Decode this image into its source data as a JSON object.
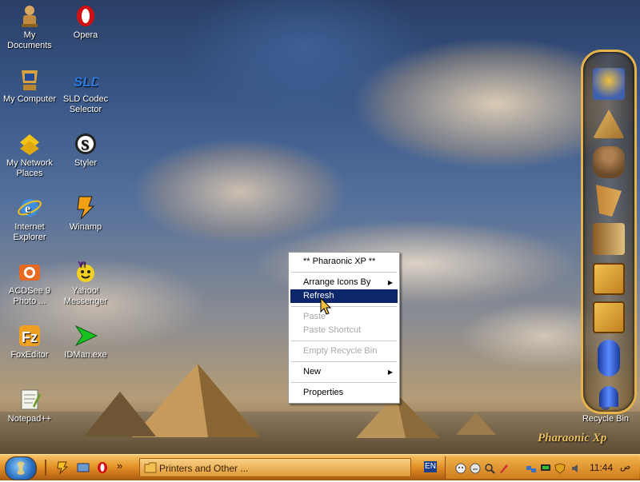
{
  "desktop_icons": [
    {
      "label": "My\nDocuments",
      "icon": "my-documents-icon"
    },
    {
      "label": "Opera",
      "icon": "opera-icon"
    },
    {
      "label": "My Computer",
      "icon": "my-computer-icon"
    },
    {
      "label": "SLD Codec\nSelector",
      "icon": "sld-codec-icon"
    },
    {
      "label": "My Network\nPlaces",
      "icon": "network-places-icon"
    },
    {
      "label": "Styler",
      "icon": "styler-icon"
    },
    {
      "label": "Internet\nExplorer",
      "icon": "internet-explorer-icon"
    },
    {
      "label": "Winamp",
      "icon": "winamp-icon"
    },
    {
      "label": "ACDSee 9\nPhoto ...",
      "icon": "acdsee-icon"
    },
    {
      "label": "Yahoo!\nMessenger",
      "icon": "yahoo-messenger-icon"
    },
    {
      "label": "FoxEditor",
      "icon": "foxeditor-icon"
    },
    {
      "label": "IDMan.exe",
      "icon": "idman-icon"
    },
    {
      "label": "Notepad++",
      "icon": "notepadpp-icon"
    },
    {
      "label": "Recycle Bin",
      "icon": "recycle-bin-icon"
    }
  ],
  "context_menu": {
    "items": [
      {
        "label": "** Pharaonic XP **",
        "enabled": true
      },
      {
        "label": "Arrange Icons By",
        "enabled": true,
        "submenu": true
      },
      {
        "label": "Refresh",
        "enabled": true,
        "selected": true
      },
      {
        "label": "Paste",
        "enabled": false
      },
      {
        "label": "Paste Shortcut",
        "enabled": false
      },
      {
        "label": "Empty Recycle Bin",
        "enabled": false
      },
      {
        "label": "New",
        "enabled": true,
        "submenu": true
      },
      {
        "label": "Properties",
        "enabled": true
      }
    ]
  },
  "branding": {
    "text": "Pharaonic Xp"
  },
  "dock": {
    "items": [
      "pharaoh-mask-icon",
      "pyramids-icon",
      "scribe-statue-icon",
      "harp-icon",
      "book-icon",
      "tools-icon",
      "registry-tool-icon",
      "capsule-icon",
      "capsule-bottom-icon"
    ]
  },
  "taskbar": {
    "task_button_label": "Printers and Other ...",
    "quick_launch_overflow": "»",
    "language": "EN",
    "clock": "11:44",
    "clock_suffix": "ص"
  },
  "colors": {
    "menu_highlight": "#0b266a",
    "taskbar_orange": "#e8992e",
    "dock_gold": "#e6b24c"
  }
}
